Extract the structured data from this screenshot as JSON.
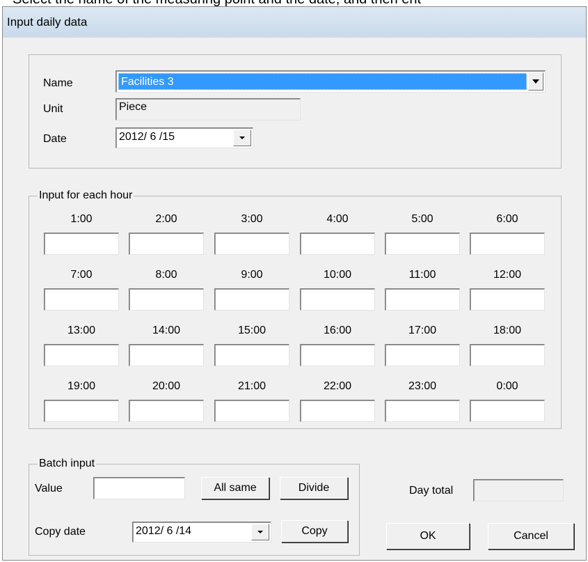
{
  "instruction": "Select the name of the measuring point and the date, and then ent",
  "window": {
    "title": "Input daily data"
  },
  "header": {
    "name_label": "Name",
    "name_value": "Facilities 3",
    "unit_label": "Unit",
    "unit_value": "Piece",
    "date_label": "Date",
    "date_value": "2012/ 6 /15"
  },
  "hours": {
    "legend": "Input for each hour",
    "items": [
      {
        "label": "1:00",
        "value": ""
      },
      {
        "label": "2:00",
        "value": ""
      },
      {
        "label": "3:00",
        "value": ""
      },
      {
        "label": "4:00",
        "value": ""
      },
      {
        "label": "5:00",
        "value": ""
      },
      {
        "label": "6:00",
        "value": ""
      },
      {
        "label": "7:00",
        "value": ""
      },
      {
        "label": "8:00",
        "value": ""
      },
      {
        "label": "9:00",
        "value": ""
      },
      {
        "label": "10:00",
        "value": ""
      },
      {
        "label": "11:00",
        "value": ""
      },
      {
        "label": "12:00",
        "value": ""
      },
      {
        "label": "13:00",
        "value": ""
      },
      {
        "label": "14:00",
        "value": ""
      },
      {
        "label": "15:00",
        "value": ""
      },
      {
        "label": "16:00",
        "value": ""
      },
      {
        "label": "17:00",
        "value": ""
      },
      {
        "label": "18:00",
        "value": ""
      },
      {
        "label": "19:00",
        "value": ""
      },
      {
        "label": "20:00",
        "value": ""
      },
      {
        "label": "21:00",
        "value": ""
      },
      {
        "label": "22:00",
        "value": ""
      },
      {
        "label": "23:00",
        "value": ""
      },
      {
        "label": "0:00",
        "value": ""
      }
    ]
  },
  "batch": {
    "legend": "Batch input",
    "value_label": "Value",
    "value": "",
    "all_same_label": "All same",
    "divide_label": "Divide",
    "copy_date_label": "Copy date",
    "copy_date_value": "2012/ 6 /14",
    "copy_label": "Copy"
  },
  "total": {
    "label": "Day total",
    "value": ""
  },
  "footer": {
    "ok_label": "OK",
    "cancel_label": "Cancel"
  },
  "icons": {
    "dropdown": "chevron-down-icon"
  }
}
